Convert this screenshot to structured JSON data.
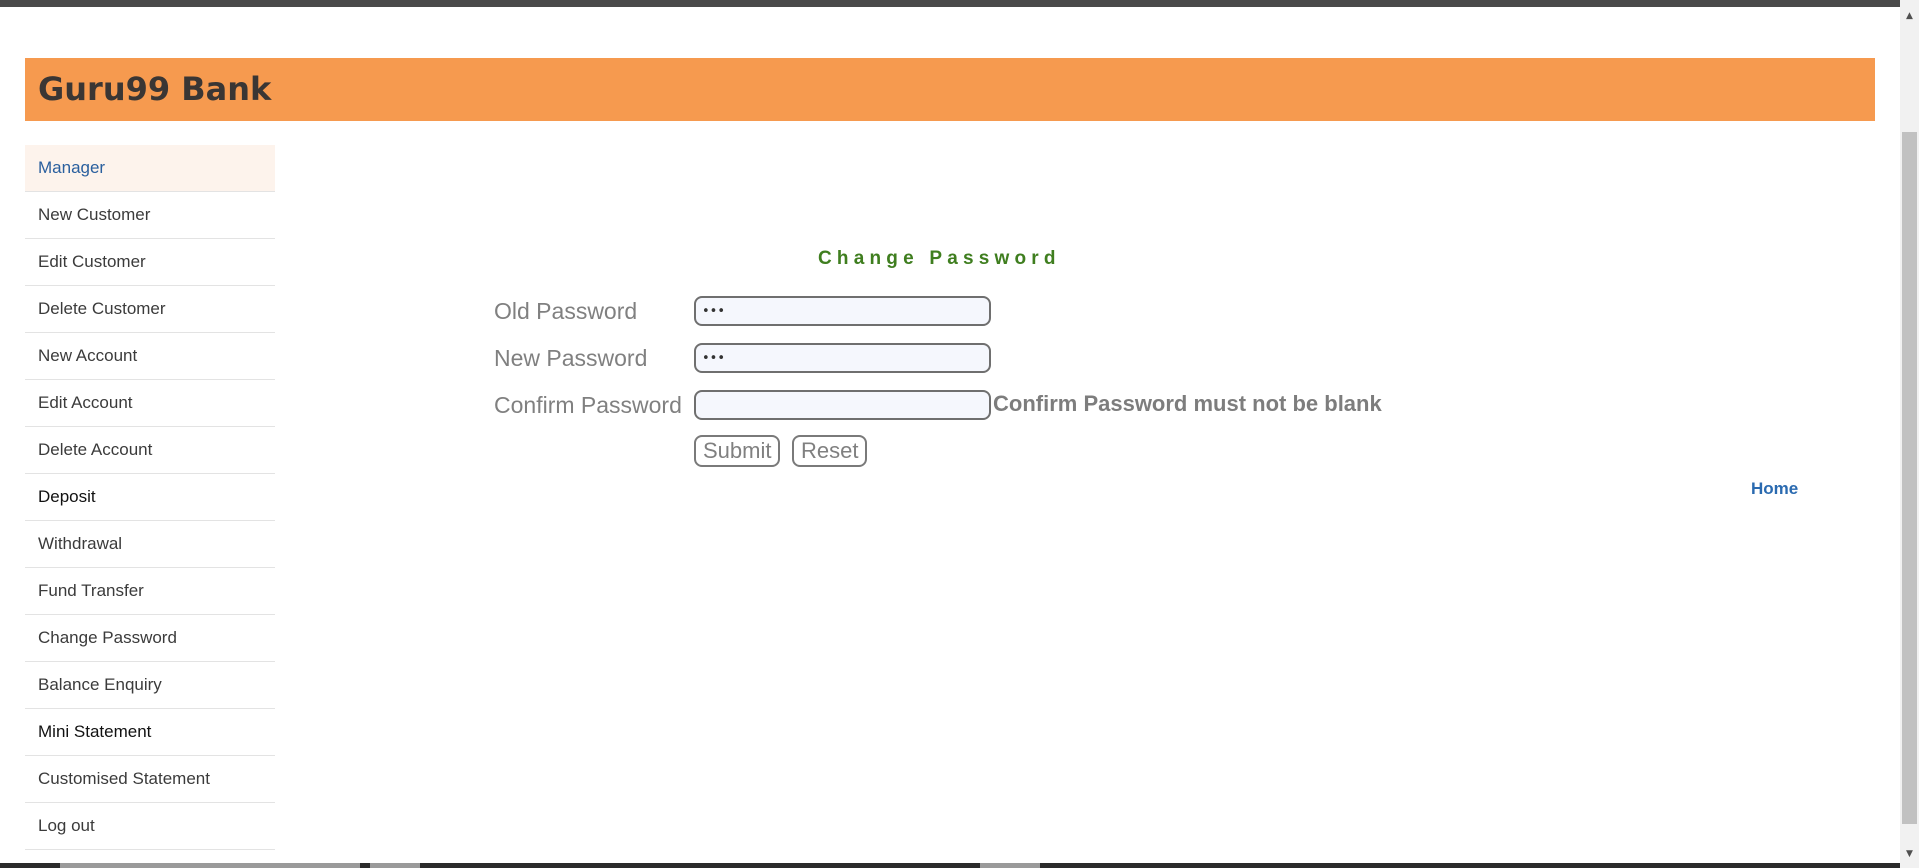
{
  "header": {
    "title": "Guru99 Bank",
    "background_color": "#f69a4f"
  },
  "sidebar": {
    "items": [
      {
        "label": "Manager",
        "active": true
      },
      {
        "label": "New Customer"
      },
      {
        "label": "Edit Customer"
      },
      {
        "label": "Delete Customer"
      },
      {
        "label": "New Account"
      },
      {
        "label": "Edit Account"
      },
      {
        "label": "Delete Account"
      },
      {
        "label": "Deposit"
      },
      {
        "label": "Withdrawal"
      },
      {
        "label": "Fund Transfer"
      },
      {
        "label": "Change Password"
      },
      {
        "label": "Balance Enquiry"
      },
      {
        "label": "Mini Statement"
      },
      {
        "label": "Customised Statement"
      },
      {
        "label": "Log out"
      }
    ]
  },
  "form": {
    "title": "Change Password",
    "title_color": "#3f7e1f",
    "old_password": {
      "label": "Old Password",
      "value": "123"
    },
    "new_password": {
      "label": "New Password",
      "value": "123"
    },
    "confirm_password": {
      "label": "Confirm Password",
      "value": ""
    },
    "error_message": "Confirm Password must not be blank",
    "submit_label": "Submit",
    "reset_label": "Reset"
  },
  "home_link": "Home",
  "link_color": "#2a6ab0",
  "icons": {
    "scroll_up": "chevron-up-icon",
    "scroll_down": "chevron-down-icon"
  }
}
